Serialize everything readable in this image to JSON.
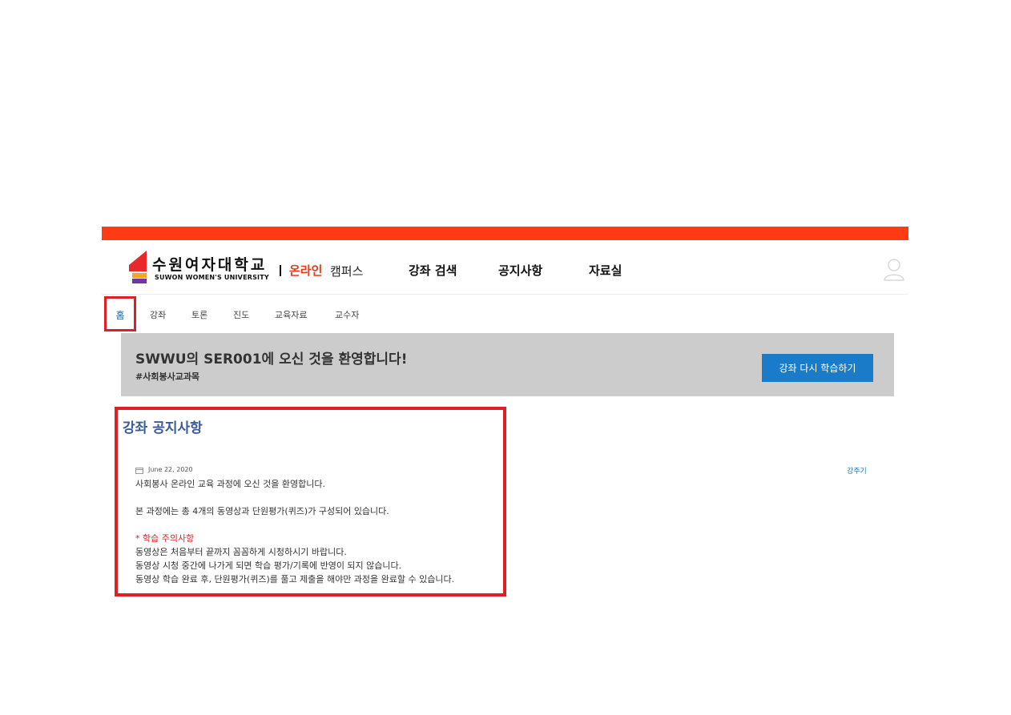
{
  "colors": {
    "accent_orange": "#fe3b12",
    "online_red": "#e8381a",
    "banner_bg": "#cccccc",
    "button_blue": "#1a7bc9",
    "title_blue": "#3b5a9a",
    "highlight_red": "#e01e25"
  },
  "header": {
    "university_name": "수원여자대학교",
    "university_name_en": "SUWON WOMEN'S UNIVERSITY",
    "online_label": "온라인",
    "campus_label": "캠퍼스",
    "user_icon": "user-icon"
  },
  "gnb": {
    "items": [
      {
        "label": "강좌 검색"
      },
      {
        "label": "공지사항"
      },
      {
        "label": "자료실"
      }
    ]
  },
  "subnav": {
    "items": [
      {
        "label": "홈"
      },
      {
        "label": "강좌"
      },
      {
        "label": "토론"
      },
      {
        "label": "진도"
      },
      {
        "label": "교육자료"
      },
      {
        "label": "교수자"
      }
    ]
  },
  "banner": {
    "title": "SWWU의 SER001에 오신 것을 환영합니다!",
    "tag": "#사회봉사교과목",
    "button_label": "강좌 다시 학습하기"
  },
  "notice": {
    "title": "강좌 공지사항",
    "date": "June 22, 2020",
    "author": "강주기",
    "lines": [
      "사회봉사 온라인 교육 과정에 오신 것을 환영합니다.",
      "본 과정에는 총 4개의 동영상과 단원평가(퀴즈)가 구성되어 있습니다.",
      "* 학습 주의사항",
      "동영상은 처음부터 끝까지 꼼꼼하게 시청하시기 바랍니다.",
      "동영상 시청 중간에 나가게 되면 학습 평가/기록에 반영이 되지 않습니다.",
      "동영상 학습 완료 후, 단원평가(퀴즈)를 풀고 제출을 해야만 과정을 완료할 수 있습니다."
    ]
  }
}
